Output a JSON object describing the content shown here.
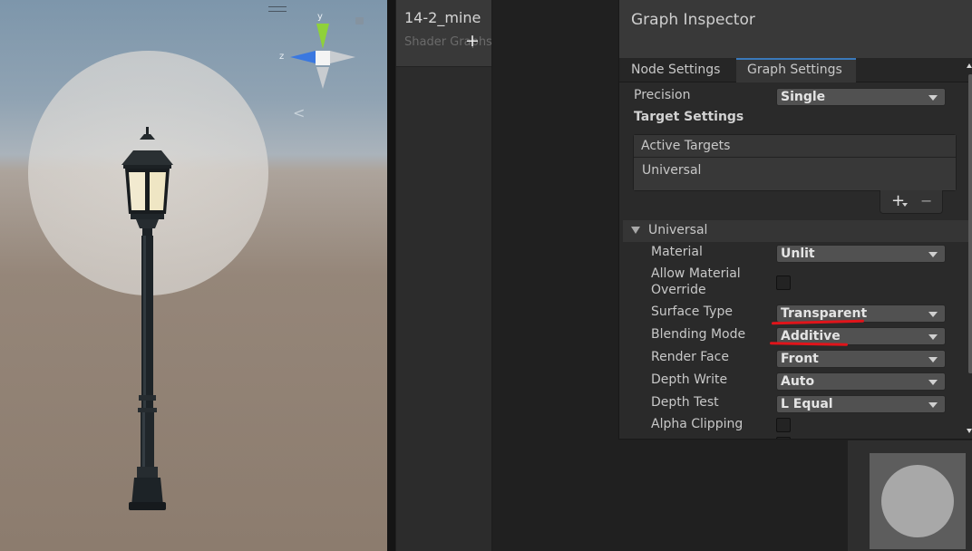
{
  "scene": {
    "gizmo": {
      "y_label": "y",
      "z_label": "z"
    },
    "back_arrow": "<"
  },
  "blackboard": {
    "title": "14-2_mine",
    "subtitle": "Shader Graphs",
    "add_label": "+"
  },
  "inspector": {
    "title": "Graph Inspector",
    "tabs": [
      {
        "label": "Node Settings",
        "active": false
      },
      {
        "label": "Graph Settings",
        "active": true
      }
    ],
    "precision": {
      "label": "Precision",
      "value": "Single"
    },
    "target_settings_label": "Target Settings",
    "active_targets": {
      "header": "Active Targets",
      "items": [
        "Universal"
      ],
      "add_label": "+",
      "remove_label": "−"
    },
    "section": {
      "label": "Universal",
      "properties": [
        {
          "label": "Material",
          "type": "dropdown",
          "value": "Unlit"
        },
        {
          "label_line1": "Allow Material",
          "label_line2": "Override",
          "type": "checkbox",
          "checked": false
        },
        {
          "label": "Surface Type",
          "type": "dropdown",
          "value": "Transparent",
          "highlighted": true
        },
        {
          "label": "Blending Mode",
          "type": "dropdown",
          "value": "Additive",
          "highlighted": true
        },
        {
          "label": "Render Face",
          "type": "dropdown",
          "value": "Front"
        },
        {
          "label": "Depth Write",
          "type": "dropdown",
          "value": "Auto"
        },
        {
          "label": "Depth Test",
          "type": "dropdown",
          "value": "L Equal"
        },
        {
          "label": "Alpha Clipping",
          "type": "checkbox",
          "checked": false
        }
      ]
    },
    "accent_color": "#3a79bb",
    "annotation_color": "#e0141a"
  }
}
